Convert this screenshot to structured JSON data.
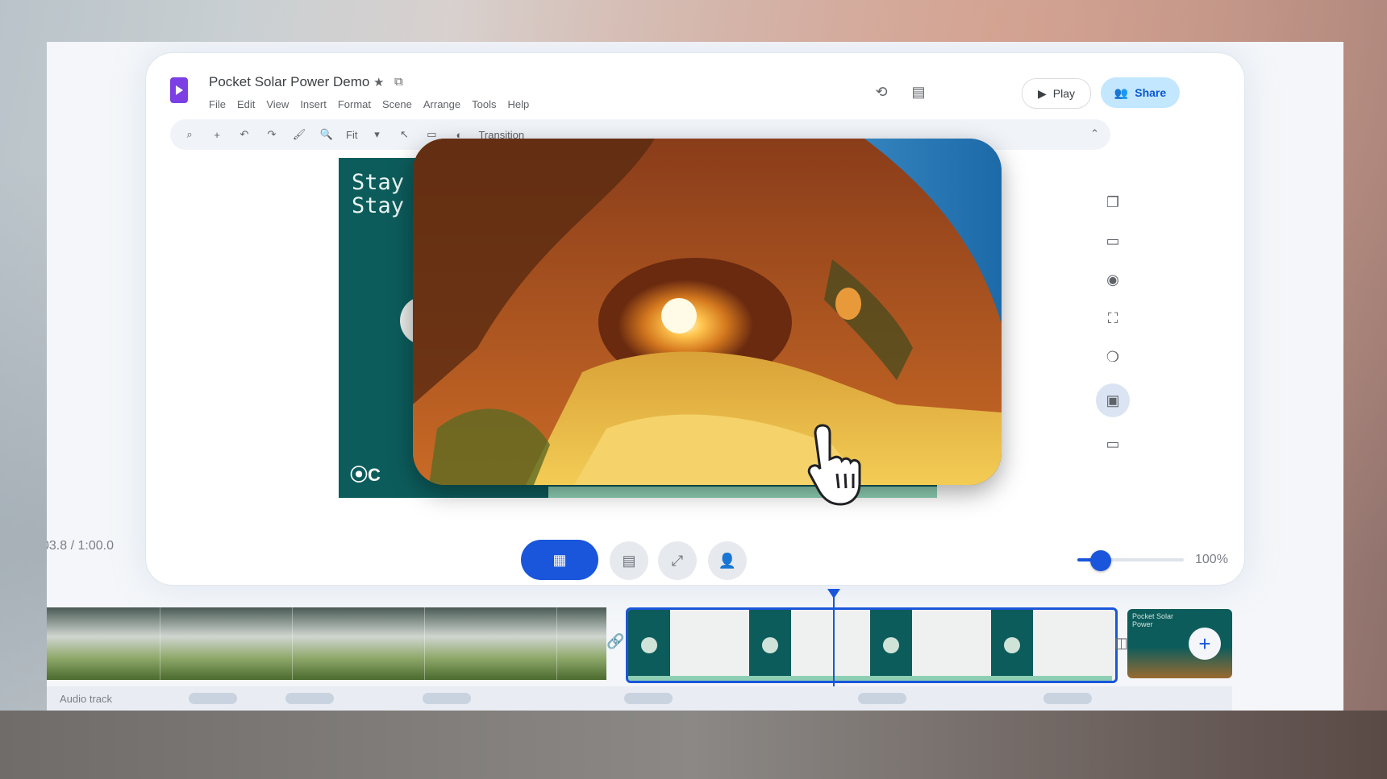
{
  "document": {
    "title": "Pocket Solar Power Demo",
    "star_icon": "star-icon",
    "move_icon": "folder-move-icon"
  },
  "menu": [
    "File",
    "Edit",
    "View",
    "Insert",
    "Format",
    "Scene",
    "Arrange",
    "Tools",
    "Help"
  ],
  "header": {
    "history_icon": "history-icon",
    "comments_icon": "comments-icon",
    "play_label": "Play",
    "share_label": "Share"
  },
  "toolbar": {
    "zoom_value": "Fit",
    "transition_label": "Transition",
    "tools": [
      "search-icon",
      "add-icon",
      "undo-icon",
      "redo-icon",
      "paint-format-icon",
      "zoom-icon"
    ]
  },
  "right_rail": [
    "layers-icon",
    "folder-icon",
    "record-icon",
    "crop-icon",
    "shapes-icon",
    "image-icon",
    "media-icon"
  ],
  "slide": {
    "title_line1": "Stay",
    "title_line2": "Stay",
    "logo": "⦿C"
  },
  "timeline": {
    "timecode": "03.8 / 1:00.0",
    "zoom_percent": "100",
    "zoom_level_fraction": 0.2,
    "audio_label": "Audio track",
    "next_clip_title": "Pocket Solar Power"
  },
  "colors": {
    "accent": "#1a56db",
    "teal": "#0d5c5c",
    "mint": "#8ecfb4",
    "share_bg": "#c2e7ff",
    "logo_purple": "#7b3fe4"
  }
}
